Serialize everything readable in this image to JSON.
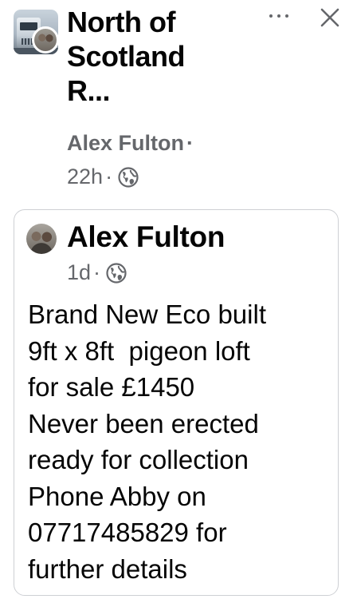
{
  "header": {
    "group_name": "North of\nScotland\nR...",
    "author": "Alex Fulton",
    "separator": "·",
    "time": "22h",
    "audience_icon": "globe-icon",
    "more_icon": "more-horizontal-icon",
    "close_icon": "close-icon"
  },
  "shared_post": {
    "author": "Alex Fulton",
    "time": "1d",
    "separator": "·",
    "audience_icon": "globe-icon",
    "body_lines": [
      "Brand New Eco built",
      "9ft x 8ft  pigeon loft",
      "for sale £1450",
      "Never been erected",
      "ready for collection",
      "Phone Abby on",
      "07717485829 for",
      "further details"
    ]
  },
  "colors": {
    "text_primary": "#050505",
    "text_secondary": "#65676b",
    "card_border": "#ced0d4",
    "background": "#ffffff"
  }
}
